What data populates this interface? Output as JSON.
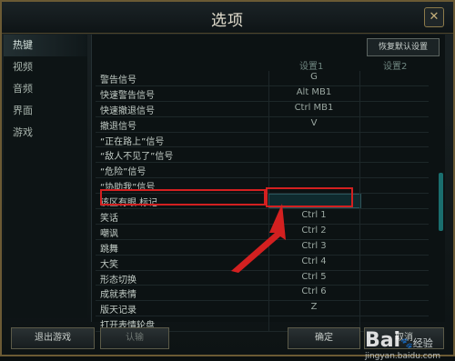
{
  "window": {
    "title": "选项",
    "close_icon": "close-icon"
  },
  "sidebar": {
    "items": [
      {
        "label": "热键",
        "active": true
      },
      {
        "label": "视频"
      },
      {
        "label": "音频"
      },
      {
        "label": "界面"
      },
      {
        "label": "游戏"
      }
    ]
  },
  "panel": {
    "restore_label": "恢复默认设置",
    "col1_label": "设置1",
    "col2_label": "设置2",
    "rows": [
      {
        "name": "警告信号",
        "v1": "G"
      },
      {
        "name": "快速警告信号",
        "v1": "Alt MB1"
      },
      {
        "name": "快速撤退信号",
        "v1": "Ctrl MB1"
      },
      {
        "name": "撤退信号",
        "v1": "V"
      },
      {
        "name": "“正在路上”信号",
        "v1": ""
      },
      {
        "name": "“敌人不见了”信号",
        "v1": ""
      },
      {
        "name": "“危险”信号",
        "v1": ""
      },
      {
        "name": "“协助我”信号",
        "v1": ""
      },
      {
        "name": "该区有眼 标记",
        "v1": "",
        "highlighted": true
      },
      {
        "name": "笑话",
        "v1": "Ctrl 1"
      },
      {
        "name": "嘲讽",
        "v1": "Ctrl 2"
      },
      {
        "name": "跳舞",
        "v1": "Ctrl 3"
      },
      {
        "name": "大笑",
        "v1": "Ctrl 4"
      },
      {
        "name": "形态切换",
        "v1": "Ctrl 5"
      },
      {
        "name": "成就表情",
        "v1": "Ctrl 6"
      },
      {
        "name": "版天记录",
        "v1": "Z"
      },
      {
        "name": "打开表情轮盘",
        "v1": ""
      }
    ]
  },
  "footer": {
    "exit_label": "退出游戏",
    "auth_label": "认输",
    "ok_label": "确定",
    "cancel_label": "取消"
  },
  "watermark": {
    "brand": "Bai",
    "brand2": "经验",
    "url": "jingyan.baidu.com"
  },
  "colors": {
    "accent": "#1a6e6e",
    "frame": "#6b5a34",
    "annotation": "#d32020"
  }
}
